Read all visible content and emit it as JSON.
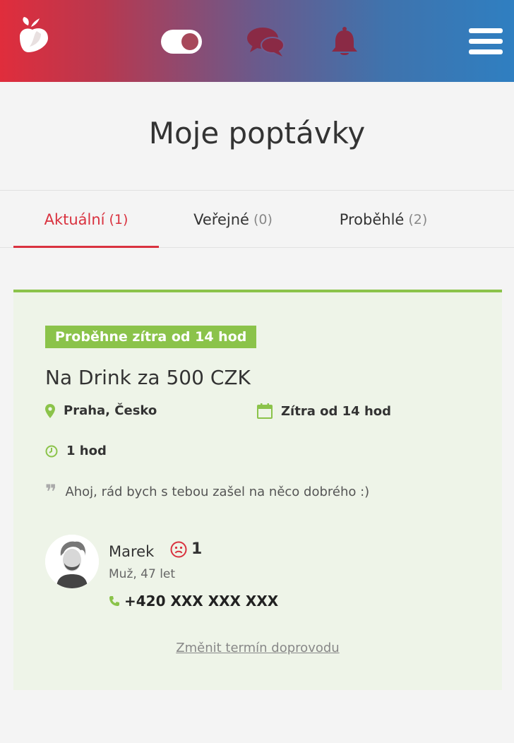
{
  "header": {
    "logo_icon": "heart-drop-logo",
    "toggle_icon": "toggle-switch-icon",
    "chat_icon": "chat-bubbles-icon",
    "bell_icon": "bell-icon",
    "menu_icon": "hamburger-menu-icon",
    "colors": {
      "gradient_start": "#e02d3c",
      "gradient_end": "#2f7fc1",
      "icon_dark": "#8a2a45"
    }
  },
  "page": {
    "title": "Moje poptávky"
  },
  "tabs": [
    {
      "label": "Aktuální",
      "count": "(1)",
      "active": true
    },
    {
      "label": "Veřejné",
      "count": "(0)",
      "active": false
    },
    {
      "label": "Proběhlé",
      "count": "(2)",
      "active": false
    }
  ],
  "request": {
    "badge": "Proběhne zítra od 14 hod",
    "title": "Na Drink za 500 CZK",
    "location": "Praha, Česko",
    "date": "Zítra od 14 hod",
    "duration": "1 hod",
    "message": "Ahoj, rád bych s tebou zašel na něco dobrého :)",
    "icons": {
      "location": "map-pin-icon",
      "date": "calendar-icon",
      "duration": "clock-icon",
      "message": "quote-icon"
    },
    "user": {
      "name": "Marek",
      "rating_icon": "sad-face-icon",
      "rating": "1",
      "info": "Muž, 47 let",
      "phone": "+420 XXX XXX XXX",
      "phone_icon": "phone-icon"
    },
    "change_link": "Změnit termín doprovodu",
    "colors": {
      "accent_green": "#8bc34a",
      "card_bg": "#eef4e8",
      "accent_red": "#d9323f"
    }
  }
}
